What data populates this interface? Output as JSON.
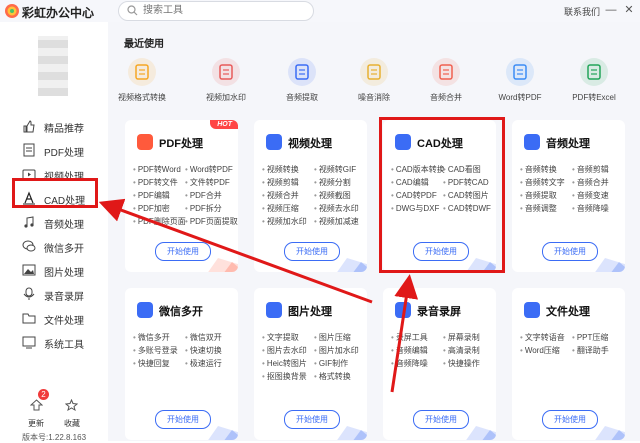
{
  "app": {
    "title": "彩虹办公中心",
    "contact": "联系我们",
    "window_controls": [
      "—",
      "✕"
    ]
  },
  "search": {
    "placeholder": "搜索工具"
  },
  "sidebar": {
    "items": [
      {
        "label": "精品推荐",
        "icon": "thumbs-up-icon"
      },
      {
        "label": "PDF处理",
        "icon": "pdf-icon"
      },
      {
        "label": "视频处理",
        "icon": "video-icon"
      },
      {
        "label": "CAD处理",
        "icon": "cad-icon"
      },
      {
        "label": "音频处理",
        "icon": "music-icon"
      },
      {
        "label": "微信多开",
        "icon": "wechat-icon"
      },
      {
        "label": "图片处理",
        "icon": "image-icon"
      },
      {
        "label": "录音录屏",
        "icon": "record-icon"
      },
      {
        "label": "文件处理",
        "icon": "folder-icon"
      },
      {
        "label": "系统工具",
        "icon": "system-icon"
      }
    ],
    "update_label": "更新",
    "update_badge": "2",
    "favorites_label": "收藏",
    "version": "版本号:1.22.8.163"
  },
  "recent": {
    "title": "最近使用",
    "items": [
      {
        "label": "视频格式转换",
        "color": "#f5a623"
      },
      {
        "label": "视频加水印",
        "color": "#e85a5a"
      },
      {
        "label": "音频提取",
        "color": "#3b6cf5"
      },
      {
        "label": "噪音消除",
        "color": "#e8b030"
      },
      {
        "label": "音频合并",
        "color": "#f06050"
      },
      {
        "label": "Word转PDF",
        "color": "#3b8cf5"
      },
      {
        "label": "PDF转Excel",
        "color": "#22a55a"
      }
    ]
  },
  "cards": [
    {
      "title": "PDF处理",
      "hot": "HOT",
      "color": "#ff5a3c",
      "left": [
        "PDF转Word",
        "PDF转文件",
        "PDF编辑",
        "PDF加密",
        "PDF删除页面"
      ],
      "right": [
        "Word转PDF",
        "文件转PDF",
        "PDF合并",
        "PDF拆分",
        "PDF页面提取"
      ],
      "button": "开始使用"
    },
    {
      "title": "视频处理",
      "color": "#3b6cf5",
      "left": [
        "视频转换",
        "视频剪辑",
        "视频合并",
        "视频压缩",
        "视频加水印"
      ],
      "right": [
        "视频转GIF",
        "视频分割",
        "视频截图",
        "视频去水印",
        "视频加减速"
      ],
      "button": "开始使用"
    },
    {
      "title": "CAD处理",
      "color": "#3b6cf5",
      "left": [
        "CAD版本转换",
        "CAD编辑",
        "CAD转PDF",
        "DWG与DXF"
      ],
      "right": [
        "CAD看图",
        "PDF转CAD",
        "CAD转图片",
        "CAD转DWF"
      ],
      "button": "开始使用"
    },
    {
      "title": "音频处理",
      "color": "#3b6cf5",
      "left": [
        "音频转换",
        "音频转文字",
        "音频提取",
        "音频调整"
      ],
      "right": [
        "音频剪辑",
        "音频合并",
        "音频变速",
        "音频降噪"
      ],
      "button": "开始使用"
    },
    {
      "title": "微信多开",
      "color": "#3b6cf5",
      "left": [
        "微信多开",
        "多账号登录",
        "快捷回复"
      ],
      "right": [
        "微信双开",
        "快速切换",
        "极速运行"
      ],
      "button": "开始使用"
    },
    {
      "title": "图片处理",
      "color": "#3b6cf5",
      "left": [
        "文字提取",
        "图片去水印",
        "Heic转图片",
        "抠图换背景"
      ],
      "right": [
        "图片压缩",
        "图片加水印",
        "GIF制作",
        "格式转换"
      ],
      "button": "开始使用"
    },
    {
      "title": "录音录屏",
      "color": "#3b6cf5",
      "left": [
        "录屏工具",
        "音频编辑",
        "音频降噪"
      ],
      "right": [
        "屏幕录制",
        "高清录制",
        "快捷操作"
      ],
      "button": "开始使用"
    },
    {
      "title": "文件处理",
      "color": "#3b6cf5",
      "left": [
        "文字转语音",
        "Word压缩"
      ],
      "right": [
        "PPT压缩",
        "翻译助手"
      ],
      "button": "开始使用"
    }
  ],
  "annotation_color": "#e01818"
}
